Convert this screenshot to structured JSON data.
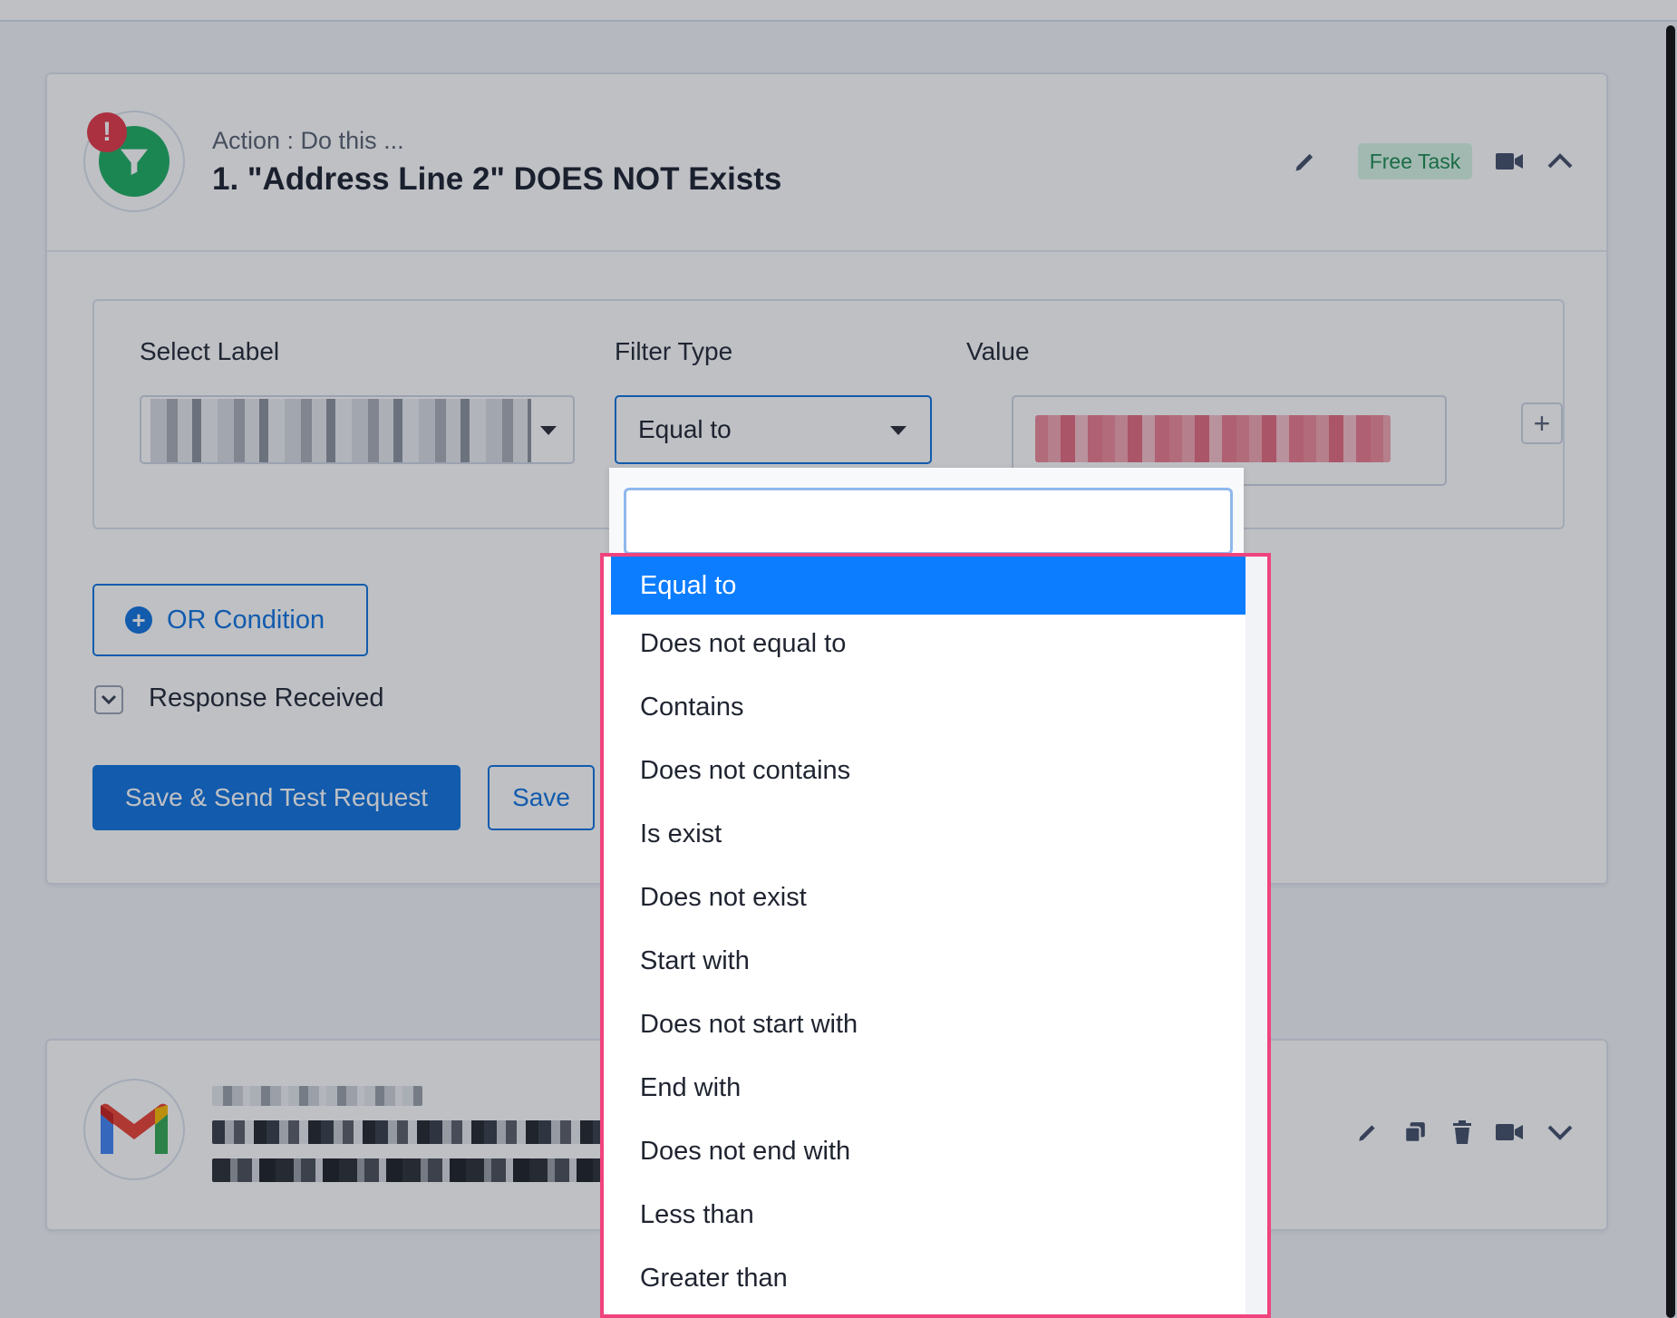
{
  "action_card": {
    "subtitle": "Action : Do this ...",
    "title": "1. \"Address Line 2\" DOES NOT Exists",
    "alert_symbol": "!",
    "badge": "Free Task",
    "icons": [
      "pencil-icon",
      "video-icon",
      "chevron-up-icon"
    ]
  },
  "condition": {
    "select_label": "Select Label",
    "filter_type_label": "Filter Type",
    "value_label": "Value",
    "filter_type_value": "Equal to",
    "plus_symbol": "+"
  },
  "buttons": {
    "or_condition": "OR Condition",
    "or_symbol": "+",
    "response_received": "Response Received",
    "save_send": "Save & Send Test Request",
    "save": "Save"
  },
  "dropdown": {
    "search_value": "",
    "options": [
      "Equal to",
      "Does not equal to",
      "Contains",
      "Does not contains",
      "Is exist",
      "Does not exist",
      "Start with",
      "Does not start with",
      "End with",
      "Does not end with",
      "Less than",
      "Greater than"
    ],
    "selected": "Equal to"
  },
  "gmail_card": {
    "icons": [
      "pencil-icon",
      "copy-icon",
      "trash-icon",
      "video-icon",
      "chevron-down-icon"
    ]
  },
  "colors": {
    "primary": "#1173e0",
    "selected_option": "#0d7dff",
    "highlight_border": "#f0437e",
    "filter_green": "#1faf63",
    "alert_red": "#e53949",
    "badge_bg": "#d9f6e6",
    "badge_text": "#1c8b4f"
  }
}
